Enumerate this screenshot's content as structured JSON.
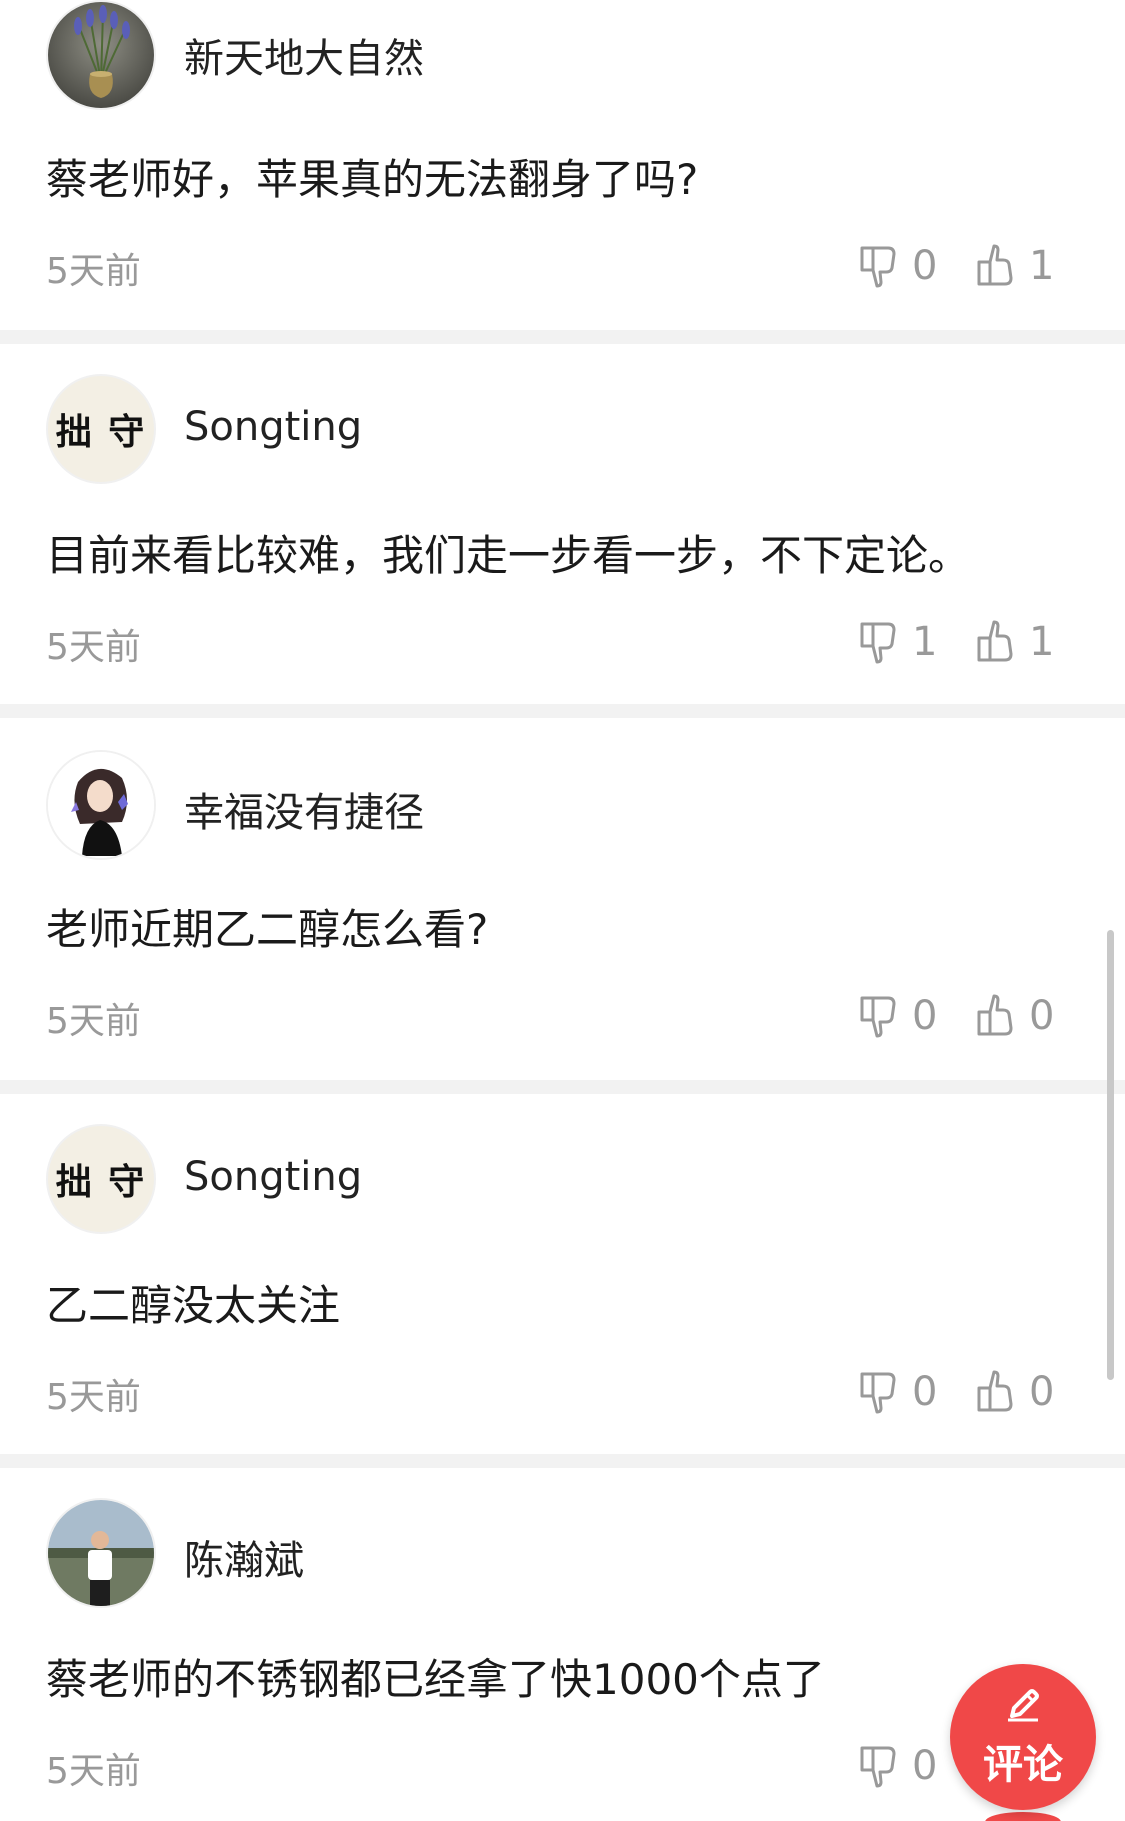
{
  "comments": [
    {
      "username": "新天地大自然",
      "avatar": "vase-flowers-avatar",
      "text": "蔡老师好，苹果真的无法翻身了吗?",
      "time": "5天前",
      "dislikes": "0",
      "likes": "1"
    },
    {
      "username": "Songting",
      "avatar": "calligraphy-avatar",
      "avatar_text": "拙 守",
      "text": "目前来看比较难，我们走一步看一步，不下定论。",
      "time": "5天前",
      "dislikes": "1",
      "likes": "1"
    },
    {
      "username": "幸福没有捷径",
      "avatar": "girl-illustration-avatar",
      "text": "老师近期乙二醇怎么看?",
      "time": "5天前",
      "dislikes": "0",
      "likes": "0"
    },
    {
      "username": "Songting",
      "avatar": "calligraphy-avatar",
      "avatar_text": "拙 守",
      "text": "乙二醇没太关注",
      "time": "5天前",
      "dislikes": "0",
      "likes": "0"
    },
    {
      "username": "陈瀚斌",
      "avatar": "person-photo-avatar",
      "text": "蔡老师的不锈钢都已经拿了快1000个点了",
      "time": "5天前",
      "dislikes": "0",
      "likes": ""
    }
  ],
  "fab": {
    "label": "评论",
    "icon": "pencil-icon"
  },
  "colors": {
    "accent": "#f04848",
    "muted": "#999999",
    "divider": "#f2f2f2"
  }
}
